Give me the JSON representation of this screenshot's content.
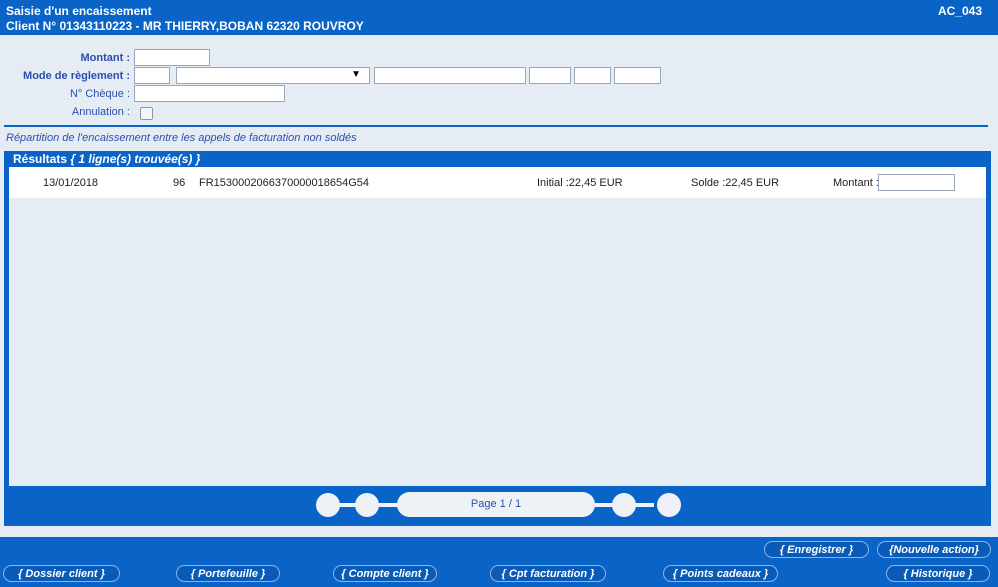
{
  "header": {
    "title": "Saisie d'un encaissement",
    "client_line": "Client N° 01343110223 - MR THIERRY,BOBAN 62320 ROUVROY",
    "screen_code": "AC_043"
  },
  "form": {
    "montant_label": "Montant :",
    "mode_label": "Mode de règlement :",
    "cheque_label": "N° Chèque :",
    "annulation_label": "Annulation :",
    "montant_value": "",
    "mode_code_value": "",
    "mode_select_value": "",
    "mode_field1_value": "",
    "mode_field2_value": "",
    "mode_field3_value": "",
    "mode_field4_value": "",
    "cheque_value": ""
  },
  "repartition_text": "Répartition de l'encaissement entre les appels de facturation non soldés",
  "results": {
    "title": "Résultats",
    "count_text": "{ 1 ligne(s) trouvée(s) }",
    "rows": [
      {
        "date": "13/01/2018",
        "num": "96",
        "ref": "FR153000206637000001865​4G54",
        "initial": "Initial :22,45 EUR",
        "solde": "Solde :22,45 EUR",
        "montant_label": "Montant :",
        "montant_value": ""
      }
    ]
  },
  "pager": {
    "label": "Page 1 / 1"
  },
  "buttons": {
    "enregistrer": "{ Enregistrer }",
    "nouvelle_action": "{Nouvelle action}",
    "dossier_client": "{ Dossier client }",
    "portefeuille": "{ Portefeuille }",
    "compte_client": "{ Compte client }",
    "cpt_facturation": "{ Cpt facturation }",
    "points_cadeaux": "{ Points cadeaux }",
    "historique": "{ Historique }"
  }
}
